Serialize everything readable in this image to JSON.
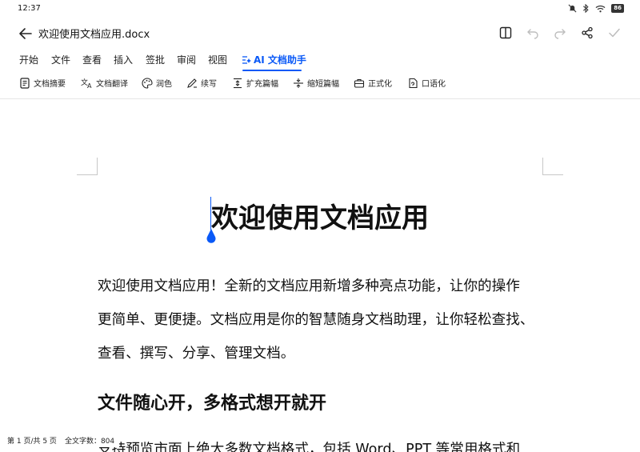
{
  "status_bar": {
    "time": "12:37",
    "battery": "86"
  },
  "title_bar": {
    "document_title": "欢迎使用文档应用.docx"
  },
  "menu": {
    "tabs": [
      "开始",
      "文件",
      "查看",
      "插入",
      "签批",
      "审阅",
      "视图",
      "AI 文档助手"
    ],
    "active_index": 7
  },
  "toolbar": {
    "items": [
      "文档摘要",
      "文档翻译",
      "润色",
      "续写",
      "扩充篇幅",
      "缩短篇幅",
      "正式化",
      "口语化"
    ]
  },
  "document": {
    "heading": "欢迎使用文档应用",
    "paragraph1_lines": [
      "欢迎使用文档应用！全新的文档应用新增多种亮点功能，让你的操作",
      "更简单、更便捷。文档应用是你的智慧随身文档助理，让你轻松查找、",
      "查看、撰写、分享、管理文档。"
    ],
    "subheading": "文件随心开，多格式想开就开",
    "paragraph2_partial": "支持预览市面上绝大多数文档格式，包括 Word、PPT 等常用格式和"
  },
  "footer": {
    "page_info": "第 1 页/共 5 页",
    "word_count": "全文字数：804"
  },
  "colors": {
    "accent": "#0a59f7",
    "text": "#111111",
    "background": "#ffffff"
  }
}
